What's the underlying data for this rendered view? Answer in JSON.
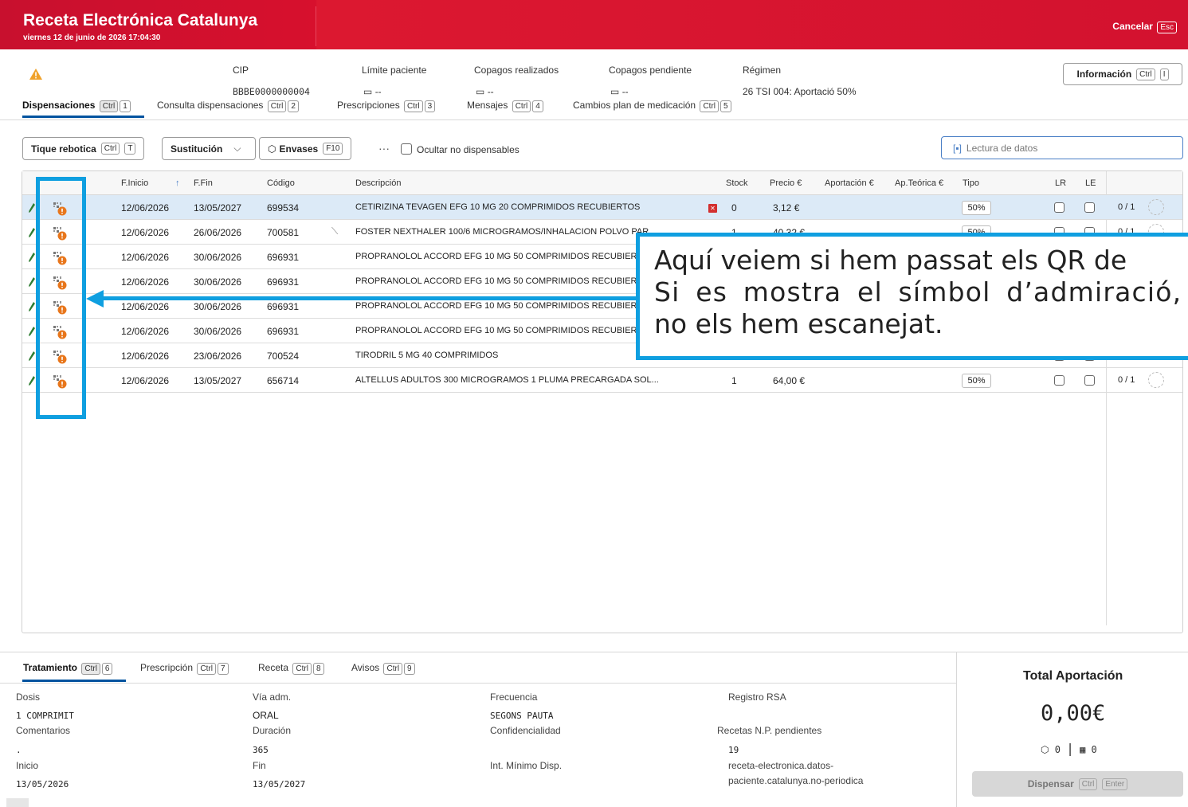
{
  "app": {
    "title": "Receta Electrónica Catalunya",
    "datetime": "viernes 12 de junio de 2026 17:04:30",
    "cancel_label": "Cancelar",
    "cancel_key": "Esc"
  },
  "patient": {
    "cip_label": "CIP",
    "cip_value": "BBBE0000000004",
    "limit_label": "Límite paciente",
    "limit_value": "--",
    "copay_done_label": "Copagos realizados",
    "copay_done_value": "--",
    "copay_pending_label": "Copagos pendiente",
    "copay_pending_value": "--",
    "regime_label": "Régimen",
    "regime_value": "26 TSI 004: Aportació 50%"
  },
  "info_button": {
    "label": "Información",
    "key1": "Ctrl",
    "key2": "I"
  },
  "tabs": [
    {
      "label": "Dispensaciones",
      "key1": "Ctrl",
      "key2": "1"
    },
    {
      "label": "Consulta dispensaciones",
      "key1": "Ctrl",
      "key2": "2"
    },
    {
      "label": "Prescripciones",
      "key1": "Ctrl",
      "key2": "3"
    },
    {
      "label": "Mensajes",
      "key1": "Ctrl",
      "key2": "4"
    },
    {
      "label": "Cambios plan de medicación",
      "key1": "Ctrl",
      "key2": "5"
    }
  ],
  "toolbar": {
    "tique_label": "Tique rebotica",
    "tique_key1": "Ctrl",
    "tique_key2": "T",
    "sustitucion_label": "Sustitución",
    "envases_label": "Envases",
    "envases_key": "F10",
    "more": "···",
    "hide_label": "Ocultar no dispensables",
    "scan_placeholder": "Lectura de datos"
  },
  "table": {
    "headers": {
      "inicio": "F.Inicio",
      "sort": "↑",
      "fin": "F.Fin",
      "codigo": "Código",
      "descripcion": "Descripción",
      "stock": "Stock",
      "precio": "Precio €",
      "aportacion": "Aportación €",
      "teorica": "Ap.Teórica €",
      "tipo": "Tipo",
      "lr": "LR",
      "le": "LE"
    },
    "rows": [
      {
        "inicio": "12/06/2026",
        "fin": "13/05/2027",
        "codigo": "699534",
        "desc": "CETIRIZINA TEVAGEN EFG 10 MG 20 COMPRIMIDOS RECUBIERTOS",
        "stock": "0",
        "precio": "3,12 €",
        "tipo": "50%",
        "count": "0 / 1"
      },
      {
        "inicio": "12/06/2026",
        "fin": "26/06/2026",
        "codigo": "700581",
        "desc": "FOSTER NEXTHALER 100/6 MICROGRAMOS/INHALACION POLVO PAR...",
        "stock": "1",
        "precio": "40,32 €",
        "tipo": "50%",
        "count": "0 / 1"
      },
      {
        "inicio": "12/06/2026",
        "fin": "30/06/2026",
        "codigo": "696931",
        "desc": "PROPRANOLOL ACCORD EFG 10 MG 50 COMPRIMIDOS RECUBIERTOS",
        "stock": "",
        "precio": "",
        "tipo": "",
        "count": ""
      },
      {
        "inicio": "12/06/2026",
        "fin": "30/06/2026",
        "codigo": "696931",
        "desc": "PROPRANOLOL ACCORD EFG 10 MG 50 COMPRIMIDOS RECUBIERTOS",
        "stock": "",
        "precio": "",
        "tipo": "",
        "count": ""
      },
      {
        "inicio": "12/06/2026",
        "fin": "30/06/2026",
        "codigo": "696931",
        "desc": "PROPRANOLOL ACCORD EFG 10 MG 50 COMPRIMIDOS RECUBIERTOS",
        "stock": "",
        "precio": "",
        "tipo": "",
        "count": ""
      },
      {
        "inicio": "12/06/2026",
        "fin": "30/06/2026",
        "codigo": "696931",
        "desc": "PROPRANOLOL ACCORD EFG 10 MG 50 COMPRIMIDOS RECUBIERTOS",
        "stock": "",
        "precio": "",
        "tipo": "",
        "count": ""
      },
      {
        "inicio": "12/06/2026",
        "fin": "23/06/2026",
        "codigo": "700524",
        "desc": "TIRODRIL 5 MG 40 COMPRIMIDOS",
        "stock": "",
        "precio": "",
        "tipo": "",
        "count": ""
      },
      {
        "inicio": "12/06/2026",
        "fin": "13/05/2027",
        "codigo": "656714",
        "desc": "ALTELLUS ADULTOS 300 MICROGRAMOS 1 PLUMA PRECARGADA SOL...",
        "stock": "1",
        "precio": "64,00 €",
        "tipo": "50%",
        "count": "0 / 1"
      }
    ]
  },
  "annotation": {
    "line1": "Aquí veiem si hem passat els QR de",
    "line2": "Si es mostra el símbol d’admiració,",
    "line3": "no els hem escanejat."
  },
  "bottom_tabs": [
    {
      "label": "Tratamiento",
      "key1": "Ctrl",
      "key2": "6"
    },
    {
      "label": "Prescripción",
      "key1": "Ctrl",
      "key2": "7"
    },
    {
      "label": "Receta",
      "key1": "Ctrl",
      "key2": "8"
    },
    {
      "label": "Avisos",
      "key1": "Ctrl",
      "key2": "9"
    }
  ],
  "details": {
    "dosis_label": "Dosis",
    "dosis_value": "1 COMPRIMIT",
    "comentarios_label": "Comentarios",
    "comentarios_value": ".",
    "inicio_label": "Inicio",
    "inicio_value": "13/05/2026",
    "via_label": "Vía adm.",
    "via_value": "ORAL",
    "duracion_label": "Duración",
    "duracion_value": "365",
    "fin_label": "Fin",
    "fin_value": "13/05/2027",
    "frecuencia_label": "Frecuencia",
    "frecuencia_value": "SEGONS PAUTA",
    "confidencialidad_label": "Confidencialidad",
    "intmin_label": "Int. Mínimo Disp.",
    "rsa_label": "Registro RSA",
    "np_label": "Recetas N.P. pendientes",
    "np_value": "19",
    "receta_type_1": "receta-electronica.datos-",
    "receta_type_2": "paciente.catalunya.no-periodica"
  },
  "totals": {
    "title": "Total Aportación",
    "value": "0,00€",
    "envases_count": "0",
    "sep": "|",
    "qr_count": "0",
    "dispense_label": "Dispensar",
    "dispense_key1": "Ctrl",
    "dispense_key2": "Enter"
  },
  "colors": {
    "brand_red": "#d7102d",
    "accent_blue": "#00539f",
    "annotation_blue": "#0f9fe0",
    "warning_orange": "#e8761b"
  }
}
